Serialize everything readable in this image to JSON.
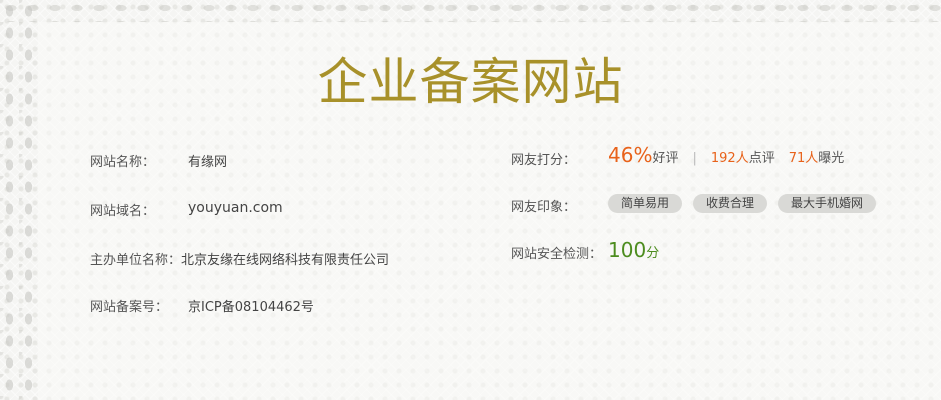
{
  "title": "企业备案网站",
  "left": {
    "site_name_label": "网站名称：",
    "site_name_value": "有缘网",
    "domain_label": "网站域名：",
    "domain_value": "youyuan.com",
    "org_label": "主办单位名称：",
    "org_value": "北京友缘在线网络科技有限责任公司",
    "icp_label": "网站备案号：",
    "icp_value": "京ICP备08104462号"
  },
  "right": {
    "rating_label": "网友打分：",
    "rating_percent": "46%",
    "rating_suffix": "好评",
    "separator": "|",
    "reviews_count": "192人",
    "reviews_suffix": "点评",
    "exposure_count": "71人",
    "exposure_suffix": "曝光",
    "impression_label": "网友印象：",
    "tags": [
      "简单易用",
      "收费合理",
      "最大手机婚网"
    ],
    "security_label": "网站安全检测：",
    "security_score": "100",
    "security_unit": "分"
  },
  "colors": {
    "title": "#a8912a",
    "accent_orange": "#e8621a",
    "accent_green": "#4c8c1e",
    "tag_bg": "#d9d9d6"
  }
}
